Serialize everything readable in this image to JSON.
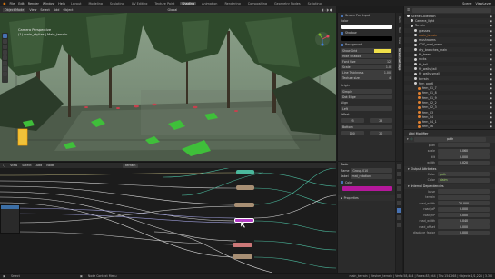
{
  "topbar": {
    "menus": [
      "File",
      "Edit",
      "Render",
      "Window",
      "Help"
    ],
    "workspaces": [
      "Layout",
      "Modeling",
      "Sculpting",
      "UV Editing",
      "Texture Paint",
      "Shading",
      "Animation",
      "Rendering",
      "Compositing",
      "Geometry Nodes",
      "Scripting"
    ],
    "active_workspace": "Shading",
    "scene": "Scene",
    "view_layer": "ViewLayer"
  },
  "viewport": {
    "header_items": [
      "Object Mode",
      "View",
      "Select",
      "Add",
      "Object"
    ],
    "global_label": "Global",
    "overlay_line1": "Camera Perspective",
    "overlay_line2": "(1) main_stylize | Main_terrain"
  },
  "npanel": {
    "rows": [
      {
        "label": "Screen Pan Input"
      },
      {
        "label": "Color"
      },
      {
        "label": "Shadow"
      },
      {
        "label": "Background"
      },
      {
        "label": "Show Grid"
      },
      {
        "label": "Hide Shadow"
      },
      {
        "label": "Font Size",
        "value": "12"
      },
      {
        "label": "Scale",
        "value": "1.0"
      },
      {
        "label": "Line Thickness",
        "value": "1.00"
      },
      {
        "label": "Texture size",
        "value": "4"
      },
      {
        "label": "Simple"
      },
      {
        "label": "Dot Edge"
      },
      {
        "label": "Left"
      },
      {
        "label": "Offset"
      },
      {
        "label": "Bottom"
      }
    ],
    "offset_values": [
      "25",
      "25"
    ],
    "extra_values": [
      "100",
      "20"
    ],
    "tabs": [
      "Item",
      "Tool",
      "View",
      "Screencast Keys"
    ]
  },
  "outliner": {
    "title": "Scene Collection",
    "items": [
      {
        "name": "Scene Collection",
        "color": "#d0d0d0",
        "depth": 0
      },
      {
        "name": "Camera_light",
        "color": "#c8c8c8",
        "depth": 1
      },
      {
        "name": "Terrain",
        "color": "#c8c8c8",
        "depth": 1
      },
      {
        "name": "grasses",
        "color": "#c8c8c8",
        "depth": 2
      },
      {
        "name": "main_terrain",
        "color": "#e08030",
        "depth": 2
      },
      {
        "name": "mushrooms",
        "color": "#c8c8c8",
        "depth": 2
      },
      {
        "name": "OOS_road_mesh",
        "color": "#c8c8c8",
        "depth": 2
      },
      {
        "name": "dry_branches_main",
        "color": "#c8c8c8",
        "depth": 2
      },
      {
        "name": "fir_trees",
        "color": "#c8c8c8",
        "depth": 2
      },
      {
        "name": "rocks",
        "color": "#c8c8c8",
        "depth": 2
      },
      {
        "name": "fir_tall",
        "color": "#c8c8c8",
        "depth": 2
      },
      {
        "name": "fir_walls_tall",
        "color": "#c8c8c8",
        "depth": 2
      },
      {
        "name": "fir_walls_small",
        "color": "#c8c8c8",
        "depth": 2
      },
      {
        "name": "terrain",
        "color": "#c8c8c8",
        "depth": 2
      },
      {
        "name": "fern_pad6",
        "color": "#c8c8c8",
        "depth": 2
      },
      {
        "name": "fern_01_7",
        "color": "#c8c8c8",
        "depth": 3
      },
      {
        "name": "fern_01_8",
        "color": "#c8c8c8",
        "depth": 3
      },
      {
        "name": "fern_01_9",
        "color": "#c8c8c8",
        "depth": 3
      },
      {
        "name": "fern_02_2",
        "color": "#c8c8c8",
        "depth": 3
      },
      {
        "name": "fern_02_3",
        "color": "#c8c8c8",
        "depth": 3
      },
      {
        "name": "fern_03",
        "color": "#c8c8c8",
        "depth": 3
      },
      {
        "name": "fern_04",
        "color": "#c8c8c8",
        "depth": 3
      },
      {
        "name": "fern_04_1",
        "color": "#c8c8c8",
        "depth": 3
      },
      {
        "name": "fern_06",
        "color": "#c8c8c8",
        "depth": 3
      }
    ]
  },
  "properties": {
    "modifier_add": "Add Modifier",
    "modifier_name": "path",
    "rows": [
      {
        "label": "path",
        "value": ""
      },
      {
        "label": "scale",
        "value": "0.060"
      },
      {
        "label": "tilt",
        "value": "0.000"
      },
      {
        "label": "width",
        "value": "0.020"
      }
    ],
    "section_output": "Output Attributes",
    "output_rows": [
      {
        "label": "Color",
        "value": "path"
      },
      {
        "label": "Color",
        "value": "claim"
      }
    ],
    "section_internal": "Internal Dependencies",
    "internal_rows": [
      {
        "label": "base",
        "value": ""
      },
      {
        "label": "terrain",
        "value": ""
      }
    ],
    "internal_nums": [
      {
        "label": "road_width",
        "value": "20.000"
      },
      {
        "label": "road_aP",
        "value": "0.000"
      },
      {
        "label": "road_hP",
        "value": "0.000"
      },
      {
        "label": "road_width",
        "value": "0.040"
      },
      {
        "label": "road_offset",
        "value": "0.000"
      },
      {
        "label": "displace_factor",
        "value": "0.000"
      }
    ]
  },
  "node_editor": {
    "header_items": [
      "View",
      "Select",
      "Add",
      "Node"
    ],
    "tree_name": "terrain",
    "side_title": "Node",
    "side_name_label": "Name",
    "side_name_value": "Group.010",
    "side_label_label": "Label",
    "side_label_value": "mat_rotation",
    "side_color_label": "Color",
    "side_properties": "Properties",
    "tabs": [
      "Node",
      "Tool",
      "View",
      "Options",
      "Group"
    ]
  },
  "status": {
    "left": "Select",
    "middle": "Node Context Menu",
    "right": "main_terrain | Meshes_terrain | Verts:58,484 | Faces:83,944 | Tris:154,268 | Objects:1/1,224 | 3.3.0"
  },
  "colors": {
    "accent": "#4772b3",
    "node_magenta": "#b43cc6",
    "node_teal": "#4bb89c",
    "node_tan": "#a88f74",
    "node_pink": "#cc7878",
    "highlight_yellow": "#f0e04a",
    "magenta_swatch": "#b4189b"
  }
}
